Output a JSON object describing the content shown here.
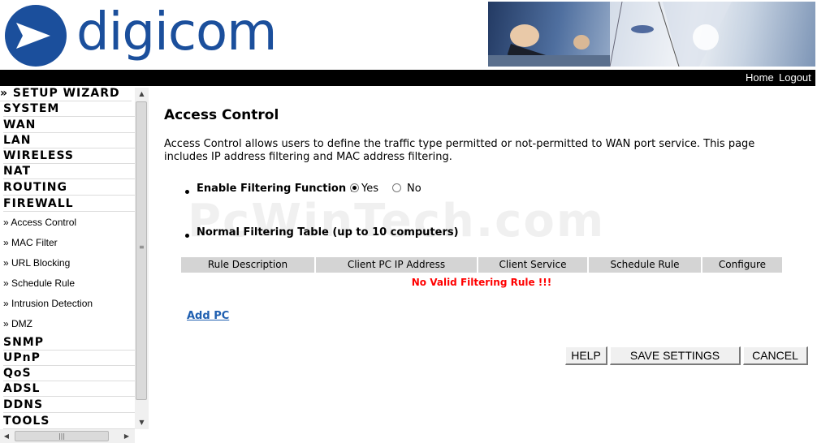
{
  "brand": {
    "name": "digicom",
    "color": "#1b4f9c"
  },
  "topbar": {
    "home": "Home",
    "logout": "Logout"
  },
  "sidebar": {
    "items": [
      {
        "label": "» SETUP WIZARD",
        "type": "main"
      },
      {
        "label": "SYSTEM",
        "type": "main"
      },
      {
        "label": "WAN",
        "type": "main"
      },
      {
        "label": "LAN",
        "type": "main"
      },
      {
        "label": "WIRELESS",
        "type": "main"
      },
      {
        "label": "NAT",
        "type": "main"
      },
      {
        "label": "ROUTING",
        "type": "main"
      },
      {
        "label": "FIREWALL",
        "type": "main"
      },
      {
        "label": "» Access Control",
        "type": "sub"
      },
      {
        "label": "» MAC Filter",
        "type": "sub"
      },
      {
        "label": "» URL Blocking",
        "type": "sub"
      },
      {
        "label": "» Schedule Rule",
        "type": "sub"
      },
      {
        "label": "» Intrusion Detection",
        "type": "sub"
      },
      {
        "label": "» DMZ",
        "type": "sub"
      },
      {
        "label": "SNMP",
        "type": "main"
      },
      {
        "label": "UPnP",
        "type": "main"
      },
      {
        "label": "QoS",
        "type": "main"
      },
      {
        "label": "ADSL",
        "type": "main"
      },
      {
        "label": "DDNS",
        "type": "main"
      },
      {
        "label": "TOOLS",
        "type": "main"
      }
    ],
    "scroll_icons": {
      "up": "scroll-up-arrow-icon",
      "down": "scroll-down-arrow-icon",
      "left": "scroll-left-arrow-icon",
      "right": "scroll-right-arrow-icon"
    }
  },
  "main": {
    "title": "Access Control",
    "description": "Access Control allows users to define the traffic type permitted or not-permitted to WAN port service. This page includes IP address filtering and MAC address filtering.",
    "enable_filtering": {
      "label": "Enable Filtering Function :",
      "options": [
        "Yes",
        "No"
      ],
      "selected": "Yes"
    },
    "table": {
      "title": "Normal Filtering Table (up to 10 computers)",
      "columns": [
        "Rule Description",
        "Client PC IP Address",
        "Client Service",
        "Schedule Rule",
        "Configure"
      ],
      "empty_message": "No Valid Filtering Rule !!!"
    },
    "add_pc": "Add PC",
    "buttons": {
      "help": "HELP",
      "save": "SAVE SETTINGS",
      "cancel": "CANCEL"
    }
  },
  "watermark": "PcWinTech.com",
  "colors": {
    "topbar": "#000000",
    "header_cell": "#d4d4d4",
    "error": "#ff0000",
    "link": "#1f5fb0"
  }
}
